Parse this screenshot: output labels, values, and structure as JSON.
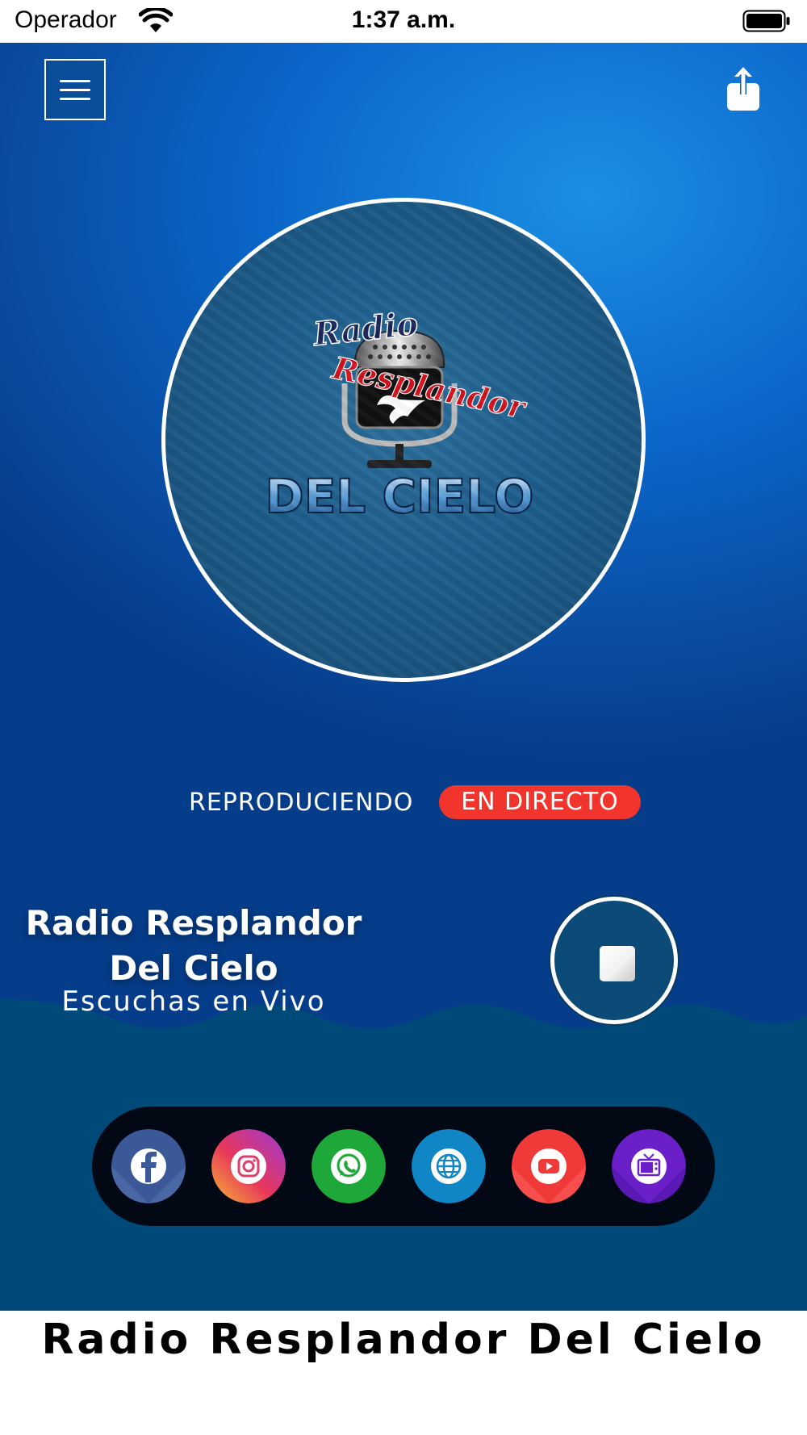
{
  "status_bar": {
    "carrier": "Operador",
    "time": "1:37 a.m."
  },
  "player": {
    "status_label": "REPRODUCIENDO",
    "live_badge": "EN  DIRECTO",
    "station_name": "Radio Resplandor Del Cielo",
    "subtitle": "Escuchas  en  Vivo"
  },
  "logo": {
    "line1": "Radio",
    "line2": "Resplandor",
    "line3": "DEL CIELO"
  },
  "social": [
    {
      "name": "facebook",
      "color": "#3b5998"
    },
    {
      "name": "instagram",
      "color": "#d6246e"
    },
    {
      "name": "whatsapp",
      "color": "#1fa83a"
    },
    {
      "name": "website",
      "color": "#1186c7"
    },
    {
      "name": "youtube",
      "color": "#f03a3a"
    },
    {
      "name": "tv",
      "color": "#6a1fc9"
    }
  ],
  "footer": {
    "title": "Radio  Resplandor  Del  Cielo"
  },
  "colors": {
    "accent_live": "#f2352c",
    "wave": "#004a7a",
    "background_blue": "#0a66c9"
  }
}
